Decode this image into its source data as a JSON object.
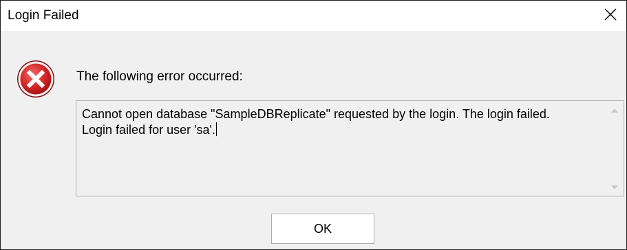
{
  "window": {
    "title": "Login Failed",
    "close_icon": "close-icon"
  },
  "message": {
    "icon": "error-icon",
    "header": "The following error occurred:"
  },
  "details": {
    "text": "Cannot open database \"SampleDBReplicate\" requested by the login. The login failed.\nLogin failed for user 'sa'.",
    "scroll_up_icon": "scroll-up-arrow-icon",
    "scroll_down_icon": "scroll-down-arrow-icon"
  },
  "buttons": {
    "ok_label": "OK"
  },
  "colors": {
    "dialog_bg": "#f0f0f0",
    "titlebar_bg": "#ffffff",
    "error_red": "#d32f2f"
  }
}
